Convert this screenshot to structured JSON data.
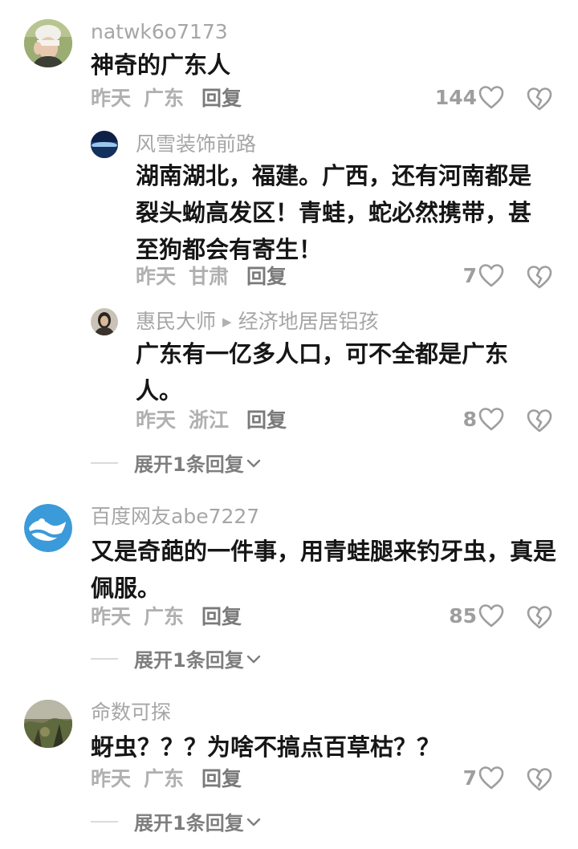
{
  "comments": [
    {
      "username": "natwk6o7173",
      "text": "神奇的广东人",
      "time": "昨天",
      "location": "广东",
      "reply_label": "回复",
      "likes": "144",
      "replies": [
        {
          "username": "风雪装饰前路",
          "text": "湖南湖北，福建。广西，还有河南都是裂头蚴高发区！青蛙，蛇必然携带，甚至狗都会有寄生！",
          "time": "昨天",
          "location": "甘肃",
          "reply_label": "回复",
          "likes": "7"
        },
        {
          "username": "惠民大师",
          "reply_to": "经济地居居铝孩",
          "text": "广东有一亿多人口，可不全都是广东人。",
          "time": "昨天",
          "location": "浙江",
          "reply_label": "回复",
          "likes": "8"
        }
      ],
      "expand_label": "展开1条回复"
    },
    {
      "username": "百度网友abe7227",
      "text": "又是奇葩的一件事，用青蛙腿来钓牙虫，真是佩服。",
      "time": "昨天",
      "location": "广东",
      "reply_label": "回复",
      "likes": "85",
      "expand_label": "展开1条回复"
    },
    {
      "username": "命数可探",
      "text": "蚜虫？？？为啥不搞点百草枯？？",
      "time": "昨天",
      "location": "广东",
      "reply_label": "回复",
      "likes": "7",
      "expand_label": "展开1条回复"
    }
  ],
  "icons": {
    "like": "heart-outline-icon",
    "dislike": "broken-heart-icon",
    "expand": "chevron-down-icon",
    "reply_to": "triangle-right-icon"
  },
  "colors": {
    "text": "#161616",
    "muted": "#a6a6a6",
    "reply": "#7a7a7a",
    "icon": "#9e9e9e"
  }
}
